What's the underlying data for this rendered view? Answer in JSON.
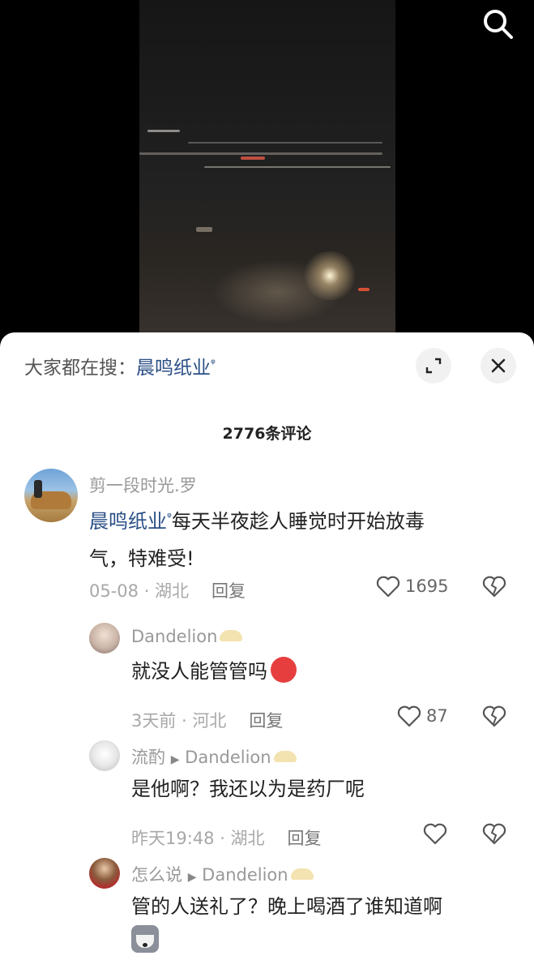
{
  "header": {
    "search_icon": "search-icon"
  },
  "sheet": {
    "hot_search_label": "大家都在搜：",
    "hot_search_term": "晨鸣纸业",
    "search_glyph": "ᵠ",
    "expand_icon": "expand-icon",
    "close_icon": "close-icon",
    "comment_count": "2776条评论"
  },
  "comments": [
    {
      "user": "剪一段时光.罗",
      "mention": "晨鸣纸业",
      "text_line1": "每天半夜趁人睡觉时开始放毒",
      "text_line2": "气，特难受!",
      "meta": "05-08 · 湖北",
      "reply_label": "回复",
      "likes": "1695"
    },
    {
      "user": "Dandelion",
      "text": "就没人能管管吗",
      "emoji": "angry-face-emoji",
      "meta": "3天前 · 河北",
      "reply_label": "回复",
      "likes": "87"
    },
    {
      "user": "流酌",
      "reply_to": "Dandelion",
      "text": "是他啊？我还以为是药厂呢",
      "meta": "昨天19:48 · 湖北",
      "reply_label": "回复",
      "likes": ""
    },
    {
      "user": "怎么说",
      "reply_to": "Dandelion",
      "text": "管的人送礼了？晚上喝酒了谁知道啊",
      "emoji": "husky-emoji"
    }
  ]
}
